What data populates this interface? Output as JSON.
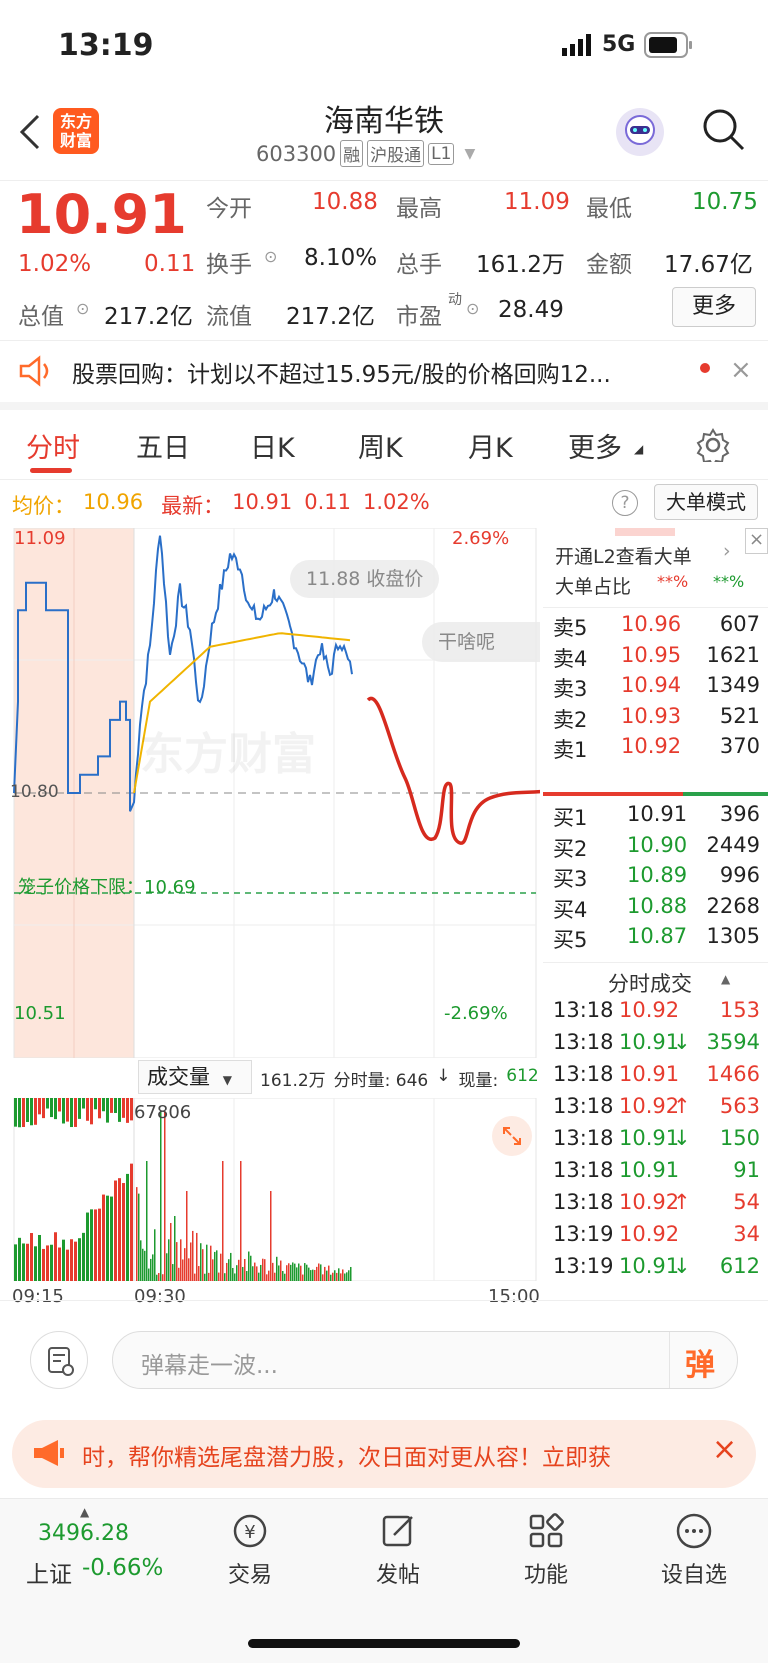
{
  "status_bar": {
    "time": "13:19",
    "network": "5G"
  },
  "header": {
    "title": "海南华铁",
    "code": "603300",
    "tag_rong": "融",
    "tag_hgt": "沪股通",
    "tag_l1": "L1",
    "brand_logo_text": "东方财富"
  },
  "quote": {
    "price": "10.91",
    "change_pct": "1.02%",
    "change": "0.11",
    "open_label": "今开",
    "open": "10.88",
    "high_label": "最高",
    "high": "11.09",
    "low_label": "最低",
    "low": "10.75",
    "turnover_label": "换手",
    "turnover": "8.10%",
    "volume_label": "总手",
    "volume": "161.2万",
    "amount_label": "金额",
    "amount": "17.67亿",
    "mktcap_label": "总值",
    "mktcap": "217.2亿",
    "float_label": "流值",
    "float": "217.2亿",
    "pe_label": "市盈",
    "pe_sup": "动",
    "pe": "28.49",
    "more_label": "更多"
  },
  "notice": {
    "text": "股票回购：计划以不超过15.95元/股的价格回购12..."
  },
  "tabs": [
    "分时",
    "五日",
    "日K",
    "周K",
    "月K",
    "更多"
  ],
  "chart_info": {
    "avg_label": "均价：",
    "avg": "10.96",
    "last_label": "最新：",
    "last": "10.91",
    "chg": "0.11",
    "chg_pct": "1.02%",
    "mode_label": "大单模式"
  },
  "chart": {
    "y_top": "11.09",
    "y_top_pct": "2.69%",
    "y_bottom": "10.51",
    "y_bottom_pct": "-2.69%",
    "y_mid": "10.80",
    "close_tip": "11.88 收盘价",
    "chat_tip": "干啥呢",
    "floor_label": "笼子价格下限：10.69",
    "watermark": "东方财富"
  },
  "volume_bar": {
    "selector": "成交量",
    "total": "161.2万",
    "tick_label": "分时量: 646",
    "current_label": "现量:",
    "current": "612",
    "peak_label": "67806",
    "x_start": "09:15",
    "x_mid": "09:30",
    "x_end": "15:00"
  },
  "order_book": {
    "l2_text": "开通L2查看大单",
    "big_order_label": "大单占比",
    "big_order_sell": "**%",
    "big_order_buy": "**%",
    "sell": [
      {
        "label": "卖5",
        "price": "10.96",
        "vol": "607"
      },
      {
        "label": "卖4",
        "price": "10.95",
        "vol": "1621"
      },
      {
        "label": "卖3",
        "price": "10.94",
        "vol": "1349"
      },
      {
        "label": "卖2",
        "price": "10.93",
        "vol": "521"
      },
      {
        "label": "卖1",
        "price": "10.92",
        "vol": "370"
      }
    ],
    "buy": [
      {
        "label": "买1",
        "price": "10.91",
        "vol": "396"
      },
      {
        "label": "买2",
        "price": "10.90",
        "vol": "2449"
      },
      {
        "label": "买3",
        "price": "10.89",
        "vol": "996"
      },
      {
        "label": "买4",
        "price": "10.88",
        "vol": "2268"
      },
      {
        "label": "买5",
        "price": "10.87",
        "vol": "1305"
      }
    ]
  },
  "ticks": {
    "title": "分时成交",
    "rows": [
      {
        "time": "13:18",
        "price": "10.92",
        "dir": "",
        "vol": "153",
        "color": "red"
      },
      {
        "time": "13:18",
        "price": "10.91",
        "dir": "↓",
        "vol": "3594",
        "color": "green"
      },
      {
        "time": "13:18",
        "price": "10.91",
        "dir": "",
        "vol": "1466",
        "color": "red"
      },
      {
        "time": "13:18",
        "price": "10.92",
        "dir": "↑",
        "vol": "563",
        "color": "red"
      },
      {
        "time": "13:18",
        "price": "10.91",
        "dir": "↓",
        "vol": "150",
        "color": "green"
      },
      {
        "time": "13:18",
        "price": "10.91",
        "dir": "",
        "vol": "91",
        "color": "green"
      },
      {
        "time": "13:18",
        "price": "10.92",
        "dir": "↑",
        "vol": "54",
        "color": "red"
      },
      {
        "time": "13:19",
        "price": "10.92",
        "dir": "",
        "vol": "34",
        "color": "red"
      },
      {
        "time": "13:19",
        "price": "10.91",
        "dir": "↓",
        "vol": "612",
        "color": "green"
      }
    ]
  },
  "comment": {
    "placeholder": "弹幕走一波...",
    "send_label": "弹"
  },
  "promo": {
    "text": "时，帮你精选尾盘潜力股，次日面对更从容！立即获"
  },
  "bottom_nav": {
    "index_value": "3496.28",
    "index_name": "上证",
    "index_change": "-0.66%",
    "items": [
      "交易",
      "发帖",
      "功能",
      "设自选"
    ]
  },
  "colors": {
    "up": "#e63b2e",
    "down": "#1d9a2f",
    "avg_line": "#f0b400",
    "price_line": "#2a6fc8"
  }
}
